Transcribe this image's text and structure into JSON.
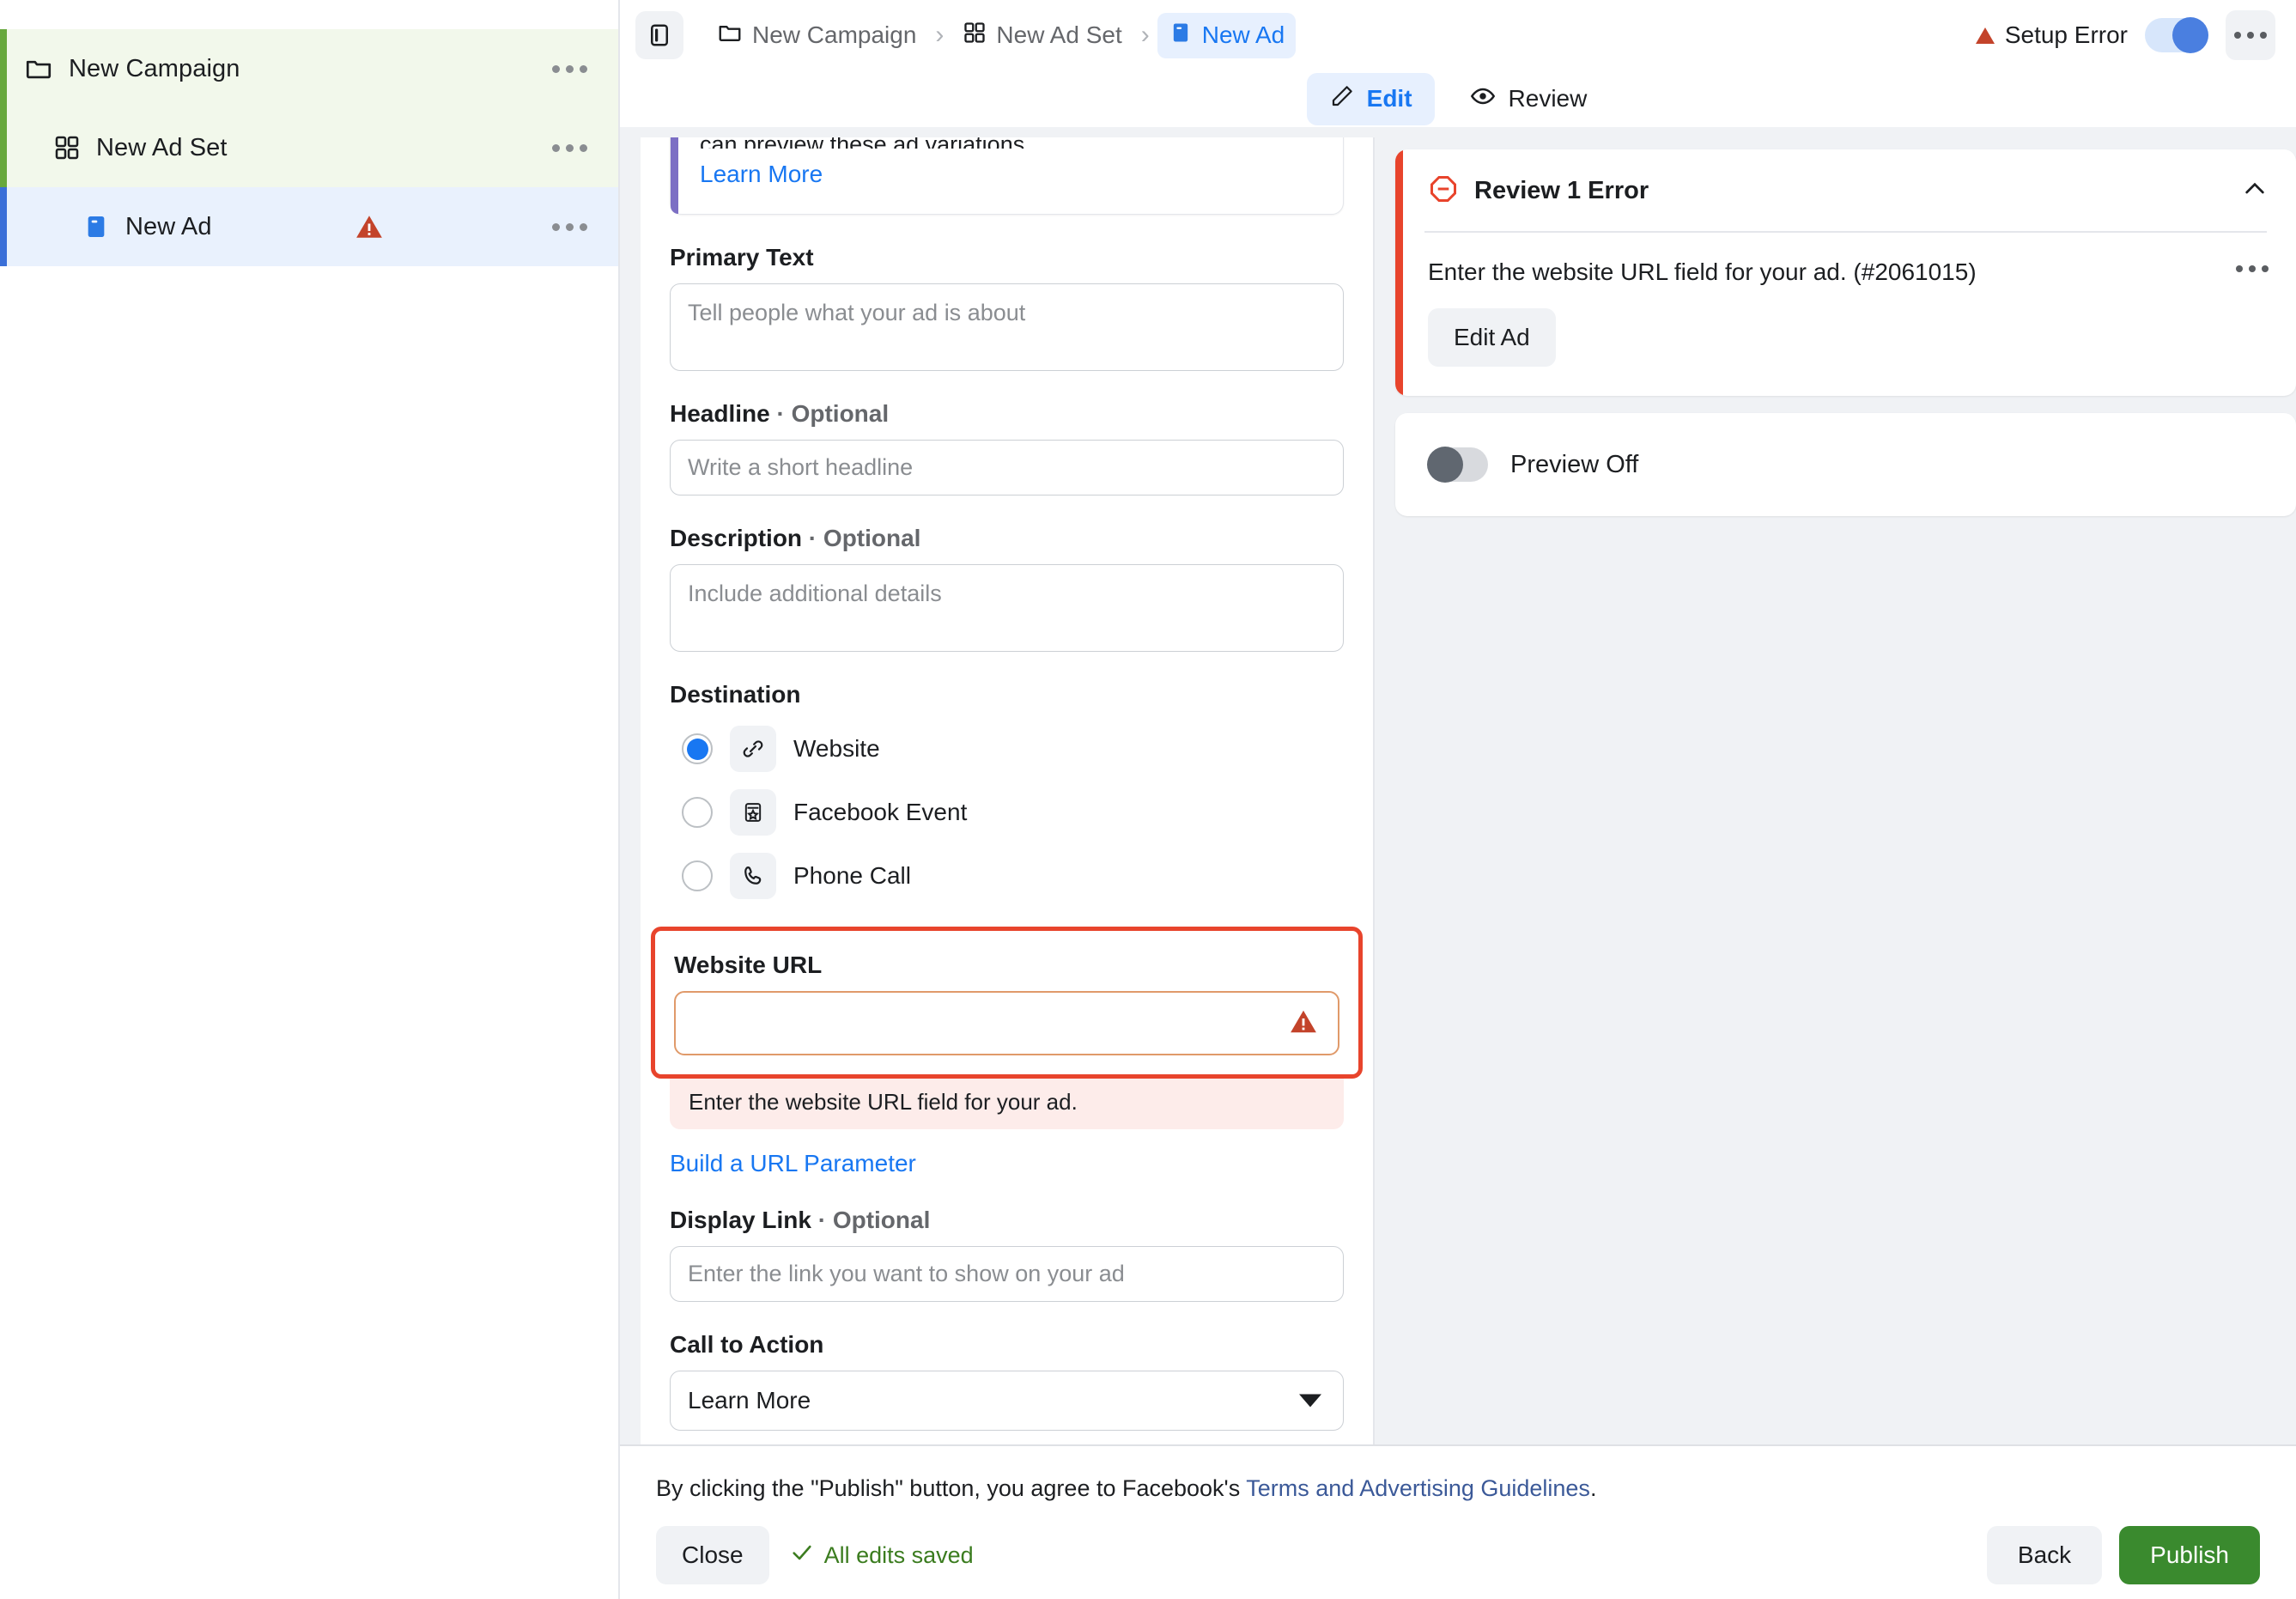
{
  "sidebar": {
    "items": [
      {
        "label": "New Campaign",
        "icon": "folder-icon",
        "level": 0,
        "state": "campaign",
        "has_warning": false
      },
      {
        "label": "New Ad Set",
        "icon": "grid-icon",
        "level": 1,
        "state": "adset",
        "has_warning": false
      },
      {
        "label": "New Ad",
        "icon": "ad-card-icon",
        "level": 2,
        "state": "ad",
        "has_warning": true
      }
    ]
  },
  "topbar": {
    "panel_toggle_icon": "sidebar-panel-icon",
    "breadcrumb": [
      {
        "label": "New Campaign",
        "icon": "folder-icon",
        "active": false
      },
      {
        "label": "New Ad Set",
        "icon": "grid-icon",
        "active": false
      },
      {
        "label": "New Ad",
        "icon": "ad-card-icon",
        "active": true
      }
    ],
    "separator": "›",
    "status_label": "Setup Error",
    "status_icon": "warning-triangle-icon",
    "toggle_state": "on",
    "overflow_icon": "more-horizontal-icon"
  },
  "tabs": [
    {
      "label": "Edit",
      "icon": "pencil-icon",
      "active": true
    },
    {
      "label": "Review",
      "icon": "eye-icon",
      "active": false
    }
  ],
  "form": {
    "banner": {
      "clipped_text": "can preview these ad variations.",
      "link_label": "Learn More"
    },
    "primary_text": {
      "label": "Primary Text",
      "placeholder": "Tell people what your ad is about",
      "value": ""
    },
    "headline": {
      "label": "Headline",
      "optional_suffix": " · Optional",
      "placeholder": "Write a short headline",
      "value": ""
    },
    "description": {
      "label": "Description",
      "optional_suffix": " · Optional",
      "placeholder": "Include additional details",
      "value": ""
    },
    "destination": {
      "label": "Destination",
      "options": [
        {
          "label": "Website",
          "icon": "link-chain-icon",
          "selected": true
        },
        {
          "label": "Facebook Event",
          "icon": "event-star-icon",
          "selected": false
        },
        {
          "label": "Phone Call",
          "icon": "phone-icon",
          "selected": false
        }
      ]
    },
    "website_url": {
      "label": "Website URL",
      "value": "",
      "placeholder": "",
      "error_message": "Enter the website URL field for your ad.",
      "warning_icon": "warning-triangle-icon"
    },
    "build_url_parameter_label": "Build a URL Parameter",
    "display_link": {
      "label": "Display Link",
      "optional_suffix": " · Optional",
      "placeholder": "Enter the link you want to show on your ad",
      "value": ""
    },
    "call_to_action": {
      "label": "Call to Action",
      "selected": "Learn More"
    }
  },
  "right_panel": {
    "error_card": {
      "icon": "error-minus-circle-icon",
      "title": "Review 1 Error",
      "collapse_icon": "chevron-up-icon",
      "message": "Enter the website URL field for your ad. (#2061015)",
      "overflow_icon": "more-horizontal-icon",
      "action_label": "Edit Ad"
    },
    "preview_card": {
      "toggle_state": "off",
      "label": "Preview Off"
    }
  },
  "footer": {
    "terms_prefix": "By clicking the \"Publish\" button, you agree to Facebook's ",
    "terms_link": "Terms and Advertising Guidelines",
    "terms_suffix": ".",
    "close_label": "Close",
    "saved_label": "All edits saved",
    "saved_icon": "check-icon",
    "back_label": "Back",
    "publish_label": "Publish"
  },
  "colors": {
    "accent_blue": "#1877f2",
    "error_red": "#e8442c",
    "publish_green": "#3a8a2e",
    "campaign_green": "#67a83c",
    "banner_purple": "#7c6fc4"
  }
}
